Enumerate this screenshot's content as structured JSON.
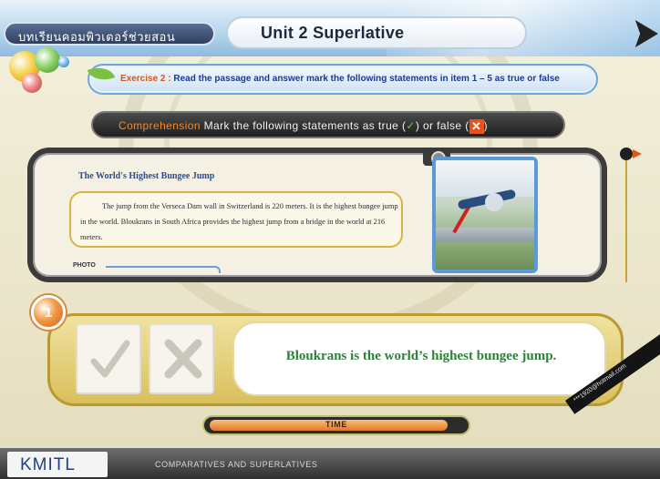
{
  "header": {
    "brand": "บทเรียนคอมพิวเตอร์ช่วยสอน",
    "unit_title": "Unit 2  Superlative"
  },
  "exercise": {
    "lead": "Exercise 2 :",
    "instruction": "Read the passage and  answer  mark the following statements in item  1 – 5  as true or false"
  },
  "comprehension": {
    "lead": "Comprehension",
    "text": "Mark the following statements as true (",
    "check": "✓",
    "or_false": ") or  false  (",
    "close": ")"
  },
  "reading": {
    "title": "The World's Highest Bungee Jump",
    "body": "The jump from the Verseca Dam wall in Switzerland is 220 meters.  It is the highest bungee jump in the world.  Bloukrans in South Africa provides the highest jump from a bridge in the world at 216 meters.",
    "photo_label": "PHOTO"
  },
  "question": {
    "number": "1",
    "statement": "Bloukrans is the world’s highest bungee jump."
  },
  "timer": {
    "label": "TIME",
    "progress": 0.94
  },
  "footer": {
    "logo": "KMITL",
    "subject": "COMPARATIVES AND SUPERLATIVES",
    "email": "***1920@hotmail.com"
  },
  "colors": {
    "statement_green": "#2f7f3a",
    "accent_orange": "#e2541c",
    "panel_gold": "#d9bf5c"
  },
  "icons": {
    "true": "check-mark-icon",
    "false": "x-mark-icon",
    "camera": "camera-icon"
  }
}
